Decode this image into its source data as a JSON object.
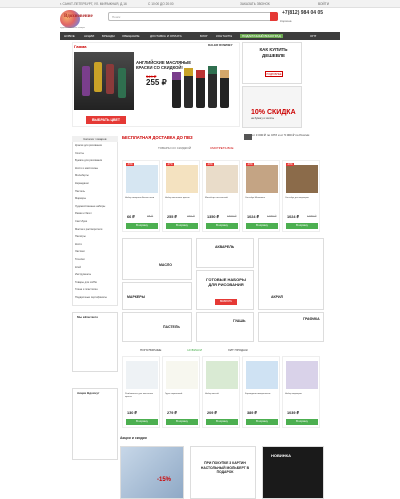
{
  "topbar": {
    "address": "г. САНКТ-ПЕТЕРБУРГ, УЛ. МИРАЖНАЯ, Д.16",
    "hours": "С 10:00 ДО 20:00",
    "callback": "ЗАКАЗАТЬ ЗВОНОК",
    "login": "ВОЙТИ"
  },
  "header": {
    "logo": "Вдохновение",
    "logo_sub": "художественные товары",
    "search_placeholder": "Поиск",
    "phone": "+7(812) 984 04 05",
    "cart": "Корзина"
  },
  "nav": [
    "НОВОЕ",
    "АКЦИИ",
    "БРЕНДЫ",
    "ОБЕЩАНИЕ",
    "ДОСТАВКА И ОПЛАТА",
    "БЛОГ",
    "КОНТАКТЫ",
    "ПОДАРОЧНЫЙ ВИНОГРАД",
    "ОПТ"
  ],
  "banner": {
    "logo": "Гамма",
    "title": "АНГЛИЙСКИЕ МАСЛЯНЫЕ КРАСКИ СО СКИДКОЙ!",
    "old_price": "349 ₽",
    "price": "255 ₽",
    "button": "ВЫБРАТЬ ЦВЕТ",
    "brand": "DALER ROWNEY"
  },
  "side1": {
    "title": "КАК КУПИТЬ ДЕШЕВЛЕ",
    "button": "ПОДРОБНЕЕ"
  },
  "side2": {
    "title": "10% СКИДКА",
    "sub": "на бумагу и холсты"
  },
  "sidebar": {
    "header": "Каталог товаров",
    "items": [
      "Краски для рисования",
      "Холсты",
      "Бумага для рисования",
      "Кисти и мастихины",
      "Мольберты",
      "Карандаши",
      "Пастель",
      "Маркеры",
      "Художественные наборы",
      "Рамки и багет",
      "Скетчбуки",
      "Масла и растворители",
      "Палитры",
      "Кисти",
      "Ластики",
      "Точилки",
      "Клей",
      "Инструменты",
      "Товары для хобби",
      "Глина и пластилин",
      "Подарочные сертификаты"
    ]
  },
  "shipping": {
    "title": "БЕСПЛАТНАЯ ДОСТАВКА ДО ПВЗ",
    "right": "от 3 000 ₽ по СПб и от 5 000 ₽ по России",
    "sub": "ТОВАРЫ СО СКИДКОЙ",
    "tab": "СМОТРЕТЬ ВСЕ"
  },
  "products": [
    {
      "name": "Набор акварели Белые ночи",
      "price": "66 ₽",
      "old": "98 ₽",
      "btn": "В корзину",
      "badge": "-33%"
    },
    {
      "name": "Набор масляных красок",
      "price": "255 ₽",
      "old": "349 ₽",
      "btn": "В корзину",
      "badge": "-27%"
    },
    {
      "name": "Мольберт настольный",
      "price": "1350 ₽",
      "old": "1690 ₽",
      "btn": "В корзину",
      "badge": "-20%"
    },
    {
      "name": "Скетчбук Малевичъ",
      "price": "1024 ₽",
      "old": "1280 ₽",
      "btn": "В корзину",
      "badge": "-20%"
    },
    {
      "name": "Скетчбук для маркеров",
      "price": "1024 ₽",
      "old": "1280 ₽",
      "btn": "В корзину",
      "badge": "-20%"
    }
  ],
  "categories": {
    "acvarel": "АКВАРЕЛЬ",
    "maslo": "МАСЛО",
    "nabory": "ГОТОВЫЕ НАБОРЫ ДЛЯ РИСОВАНИЯ",
    "nabory_btn": "ВЫБРАТЬ",
    "akril": "АКРИЛ",
    "markery": "МАРКЕРЫ",
    "pastel": "ПАСТЕЛЬ",
    "guash": "ГУАШЬ",
    "grafika": "ГРАФИКА"
  },
  "social": {
    "title": "Мы вКонтакте"
  },
  "reviews": {
    "title": "Акции Вдохнут"
  },
  "section2": {
    "tabs": [
      "ПОПУЛЯРНЫЕ",
      "НОВИНКИ",
      "ХИТ ПРОДАЖ"
    ]
  },
  "products2": [
    {
      "name": "Разбавитель для масляных красок",
      "price": "130 ₽",
      "btn": "В корзину"
    },
    {
      "name": "Грунт акриловый",
      "price": "279 ₽",
      "btn": "В корзину"
    },
    {
      "name": "Набор кистей",
      "price": "209 ₽",
      "btn": "В корзину"
    },
    {
      "name": "Карандаши акварельные",
      "price": "389 ₽",
      "btn": "В корзину"
    },
    {
      "name": "Набор маркеров",
      "price": "1039 ₽",
      "btn": "В корзину"
    }
  ],
  "promo": {
    "title": "Акции и скидки",
    "p1": "-15%",
    "p2": "ПРИ ПОКУПКЕ 3 КАРТИН НАСТОЛЬНЫЙ МОЛЬБЕРТ В ПОДАРОК",
    "p3": "НОВИНКА"
  },
  "colors": {
    "accent": "#e53935",
    "green": "#4caf50",
    "nav": "#3d3d3d"
  }
}
